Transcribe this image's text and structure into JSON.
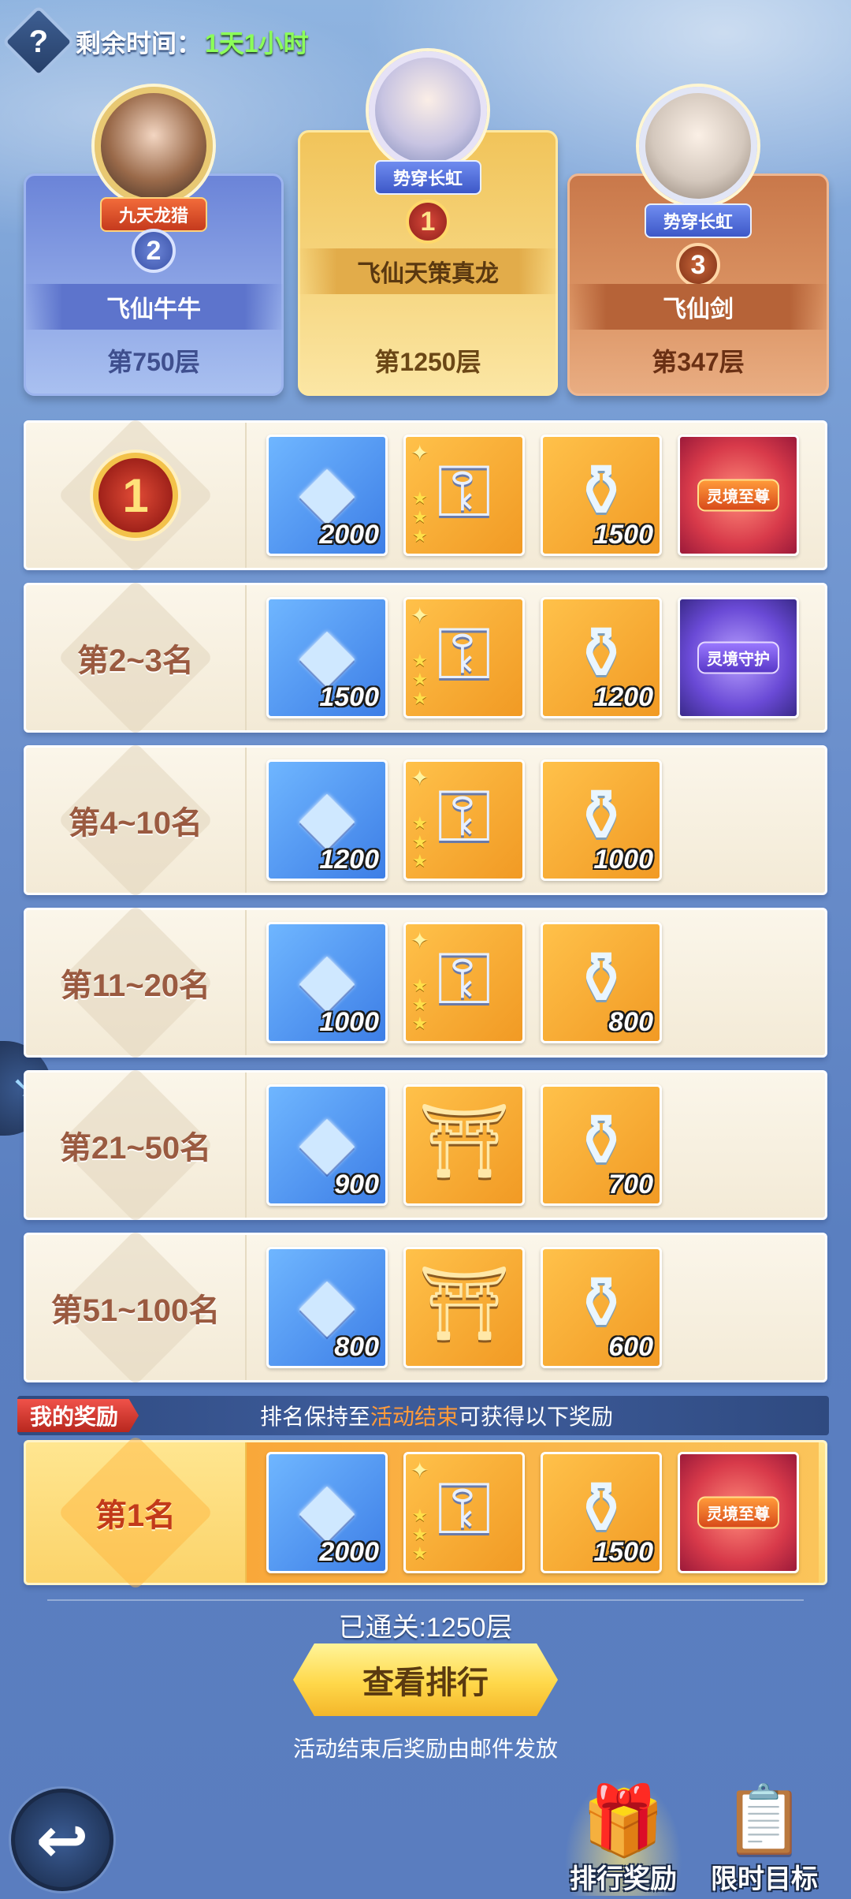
{
  "header": {
    "help_icon": "question-mark",
    "remaining_label": "剩余时间：",
    "remaining_value": "1天1小时"
  },
  "podium": [
    {
      "rank": "2",
      "name": "飞仙牛牛",
      "floor": "第750层",
      "title_banner": "九天龙猎"
    },
    {
      "rank": "1",
      "name": "飞仙天策真龙",
      "floor": "第1250层",
      "title_banner": "势穿长虹"
    },
    {
      "rank": "3",
      "name": "飞仙剑",
      "floor": "第347层",
      "title_banner": "势穿长虹"
    }
  ],
  "reward_tiers": [
    {
      "rank_label": "1",
      "items": [
        {
          "type": "diamond",
          "qty": "2000"
        },
        {
          "type": "stairs",
          "qty": ""
        },
        {
          "type": "vase",
          "qty": "1500"
        },
        {
          "type": "title-card",
          "qty": "",
          "card_text": "灵境至尊"
        }
      ]
    },
    {
      "rank_label": "第2~3名",
      "items": [
        {
          "type": "diamond",
          "qty": "1500"
        },
        {
          "type": "stairs",
          "qty": ""
        },
        {
          "type": "vase",
          "qty": "1200"
        },
        {
          "type": "title-card",
          "qty": "",
          "card_text": "灵境守护"
        }
      ]
    },
    {
      "rank_label": "第4~10名",
      "items": [
        {
          "type": "diamond",
          "qty": "1200"
        },
        {
          "type": "stairs",
          "qty": ""
        },
        {
          "type": "vase",
          "qty": "1000"
        }
      ]
    },
    {
      "rank_label": "第11~20名",
      "items": [
        {
          "type": "diamond",
          "qty": "1000"
        },
        {
          "type": "stairs",
          "qty": ""
        },
        {
          "type": "vase",
          "qty": "800"
        }
      ]
    },
    {
      "rank_label": "第21~50名",
      "items": [
        {
          "type": "diamond",
          "qty": "900"
        },
        {
          "type": "shrine",
          "qty": ""
        },
        {
          "type": "vase",
          "qty": "700"
        }
      ]
    },
    {
      "rank_label": "第51~100名",
      "items": [
        {
          "type": "diamond",
          "qty": "800"
        },
        {
          "type": "shrine",
          "qty": ""
        },
        {
          "type": "vase",
          "qty": "600"
        }
      ]
    }
  ],
  "my_reward": {
    "tag": "我的奖励",
    "desc_prefix": "排名保持至",
    "desc_highlight": "活动结束",
    "desc_suffix": "可获得以下奖励",
    "rank_label": "第1名",
    "items": [
      {
        "type": "diamond",
        "qty": "2000"
      },
      {
        "type": "stairs",
        "qty": ""
      },
      {
        "type": "vase",
        "qty": "1500"
      },
      {
        "type": "title-card",
        "qty": "",
        "card_text": "灵境至尊"
      }
    ]
  },
  "footer": {
    "cleared": "已通关:1250层",
    "view_ranking_button": "查看排行",
    "mail_note": "活动结束后奖励由邮件发放"
  },
  "bottom_nav": {
    "back_icon": "return-arrow",
    "tab_rank_reward": "排行奖励",
    "tab_limited_goal": "限时目标"
  },
  "colors": {
    "time_green": "#8cff5a",
    "highlight_orange": "#ff9a3a",
    "gold_button": "#ffd84a"
  }
}
